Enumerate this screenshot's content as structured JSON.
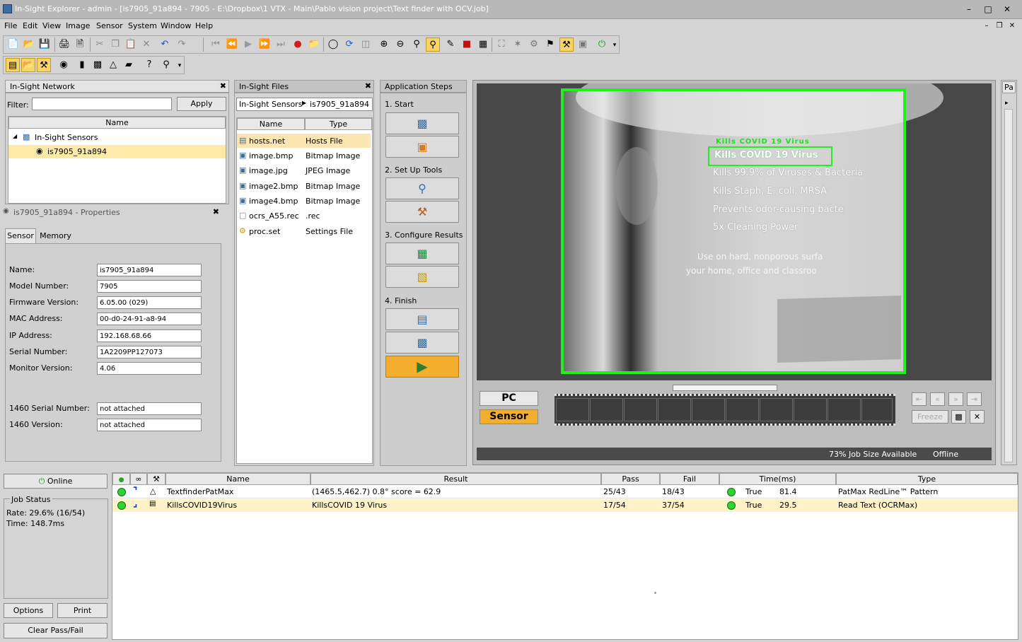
{
  "window": {
    "title": "In-Sight Explorer - admin - [is7905_91a894 - 7905 - E:\\Dropbox\\1 VTX - Main\\Pablo vision project\\Text finder with OCV.job]"
  },
  "menu": [
    "File",
    "Edit",
    "View",
    "Image",
    "Sensor",
    "System",
    "Window",
    "Help"
  ],
  "network_panel": {
    "title": "In-Sight Network",
    "filter_label": "Filter:",
    "filter_value": "",
    "apply_label": "Apply",
    "column": "Name",
    "tree": {
      "root": "In-Sight Sensors",
      "child": "is7905_91a894"
    }
  },
  "properties_panel": {
    "title": "is7905_91a894 - Properties",
    "tabs": [
      "Sensor",
      "Memory"
    ],
    "fields": [
      {
        "label": "Name:",
        "value": "is7905_91a894"
      },
      {
        "label": "Model Number:",
        "value": "7905"
      },
      {
        "label": "Firmware Version:",
        "value": "6.05.00 (029)"
      },
      {
        "label": "MAC Address:",
        "value": "00-d0-24-91-a8-94"
      },
      {
        "label": "IP Address:",
        "value": "192.168.68.66"
      },
      {
        "label": "Serial Number:",
        "value": "1A2209PP127073"
      },
      {
        "label": "Monitor Version:",
        "value": "4.06"
      }
    ],
    "extra_fields": [
      {
        "label": "1460 Serial Number:",
        "value": "not attached"
      },
      {
        "label": "1460 Version:",
        "value": "not attached"
      }
    ]
  },
  "files_panel": {
    "title": "In-Sight Files",
    "breadcrumb_root": "In-Sight Sensors",
    "breadcrumb_leaf": "is7905_91a894",
    "columns": [
      "Name",
      "Type"
    ],
    "files": [
      {
        "name": "hosts.net",
        "type": "Hosts File",
        "icon": "network-file-icon"
      },
      {
        "name": "image.bmp",
        "type": "Bitmap Image",
        "icon": "image-file-icon"
      },
      {
        "name": "image.jpg",
        "type": "JPEG Image",
        "icon": "image-file-icon"
      },
      {
        "name": "image2.bmp",
        "type": "Bitmap Image",
        "icon": "image-file-icon"
      },
      {
        "name": "image4.bmp",
        "type": "Bitmap Image",
        "icon": "image-file-icon"
      },
      {
        "name": "ocrs_A55.rec",
        "type": ".rec",
        "icon": "blank-file-icon"
      },
      {
        "name": "proc.set",
        "type": "Settings File",
        "icon": "settings-file-icon"
      }
    ]
  },
  "app_steps": {
    "title": "Application Steps",
    "sections": [
      "1. Start",
      "2. Set Up Tools",
      "3. Configure Results",
      "4. Finish"
    ]
  },
  "image_view": {
    "label_lines": [
      "Kills COVID 19 Virus",
      "Kills 99.9% of Viruses & Bacteria",
      "Kills Staph, E. coli, MRSA",
      "Prevents odor-causing bacte",
      "5x Cleaning Power",
      "Use on hard, nonporous surfa",
      "your home, office and classroo"
    ],
    "overlay_text": "Kills COVID 19 Virus",
    "pc_label": "PC",
    "sensor_label": "Sensor",
    "freeze_label": "Freeze",
    "filmstrip_frames": 10,
    "status_job": "73% Job Size Available",
    "status_online": "Offline",
    "side_tab": "Pa"
  },
  "left_controls": {
    "online_label": "Online",
    "job_status_title": "Job Status",
    "rate": "Rate: 29.6% (16/54)",
    "time": "Time: 148.7ms",
    "options_label": "Options",
    "print_label": "Print",
    "clear_label": "Clear Pass/Fail"
  },
  "results_table": {
    "columns": [
      "Name",
      "Result",
      "Pass",
      "Fail",
      "Time(ms)",
      "Type"
    ],
    "rows": [
      {
        "name": "TextfinderPatMax",
        "result": "(1465.5,462.7) 0.8° score = 62.9",
        "pass": "25/43",
        "fail": "18/43",
        "state": "True",
        "time": "81.4",
        "type": "PatMax RedLine™ Pattern"
      },
      {
        "name": "KillsCOVID19Virus",
        "result": "KillsCOVID 19 Virus",
        "pass": "17/54",
        "fail": "37/54",
        "state": "True",
        "time": "29.5",
        "type": "Read Text (OCRMax)"
      }
    ]
  },
  "colors": {
    "accent": "#f7d46a",
    "run_button": "#f2ae2c",
    "overlay_green": "#22ee22",
    "pass_green": "#2ed52e",
    "selected_row": "#fdf2c8"
  }
}
